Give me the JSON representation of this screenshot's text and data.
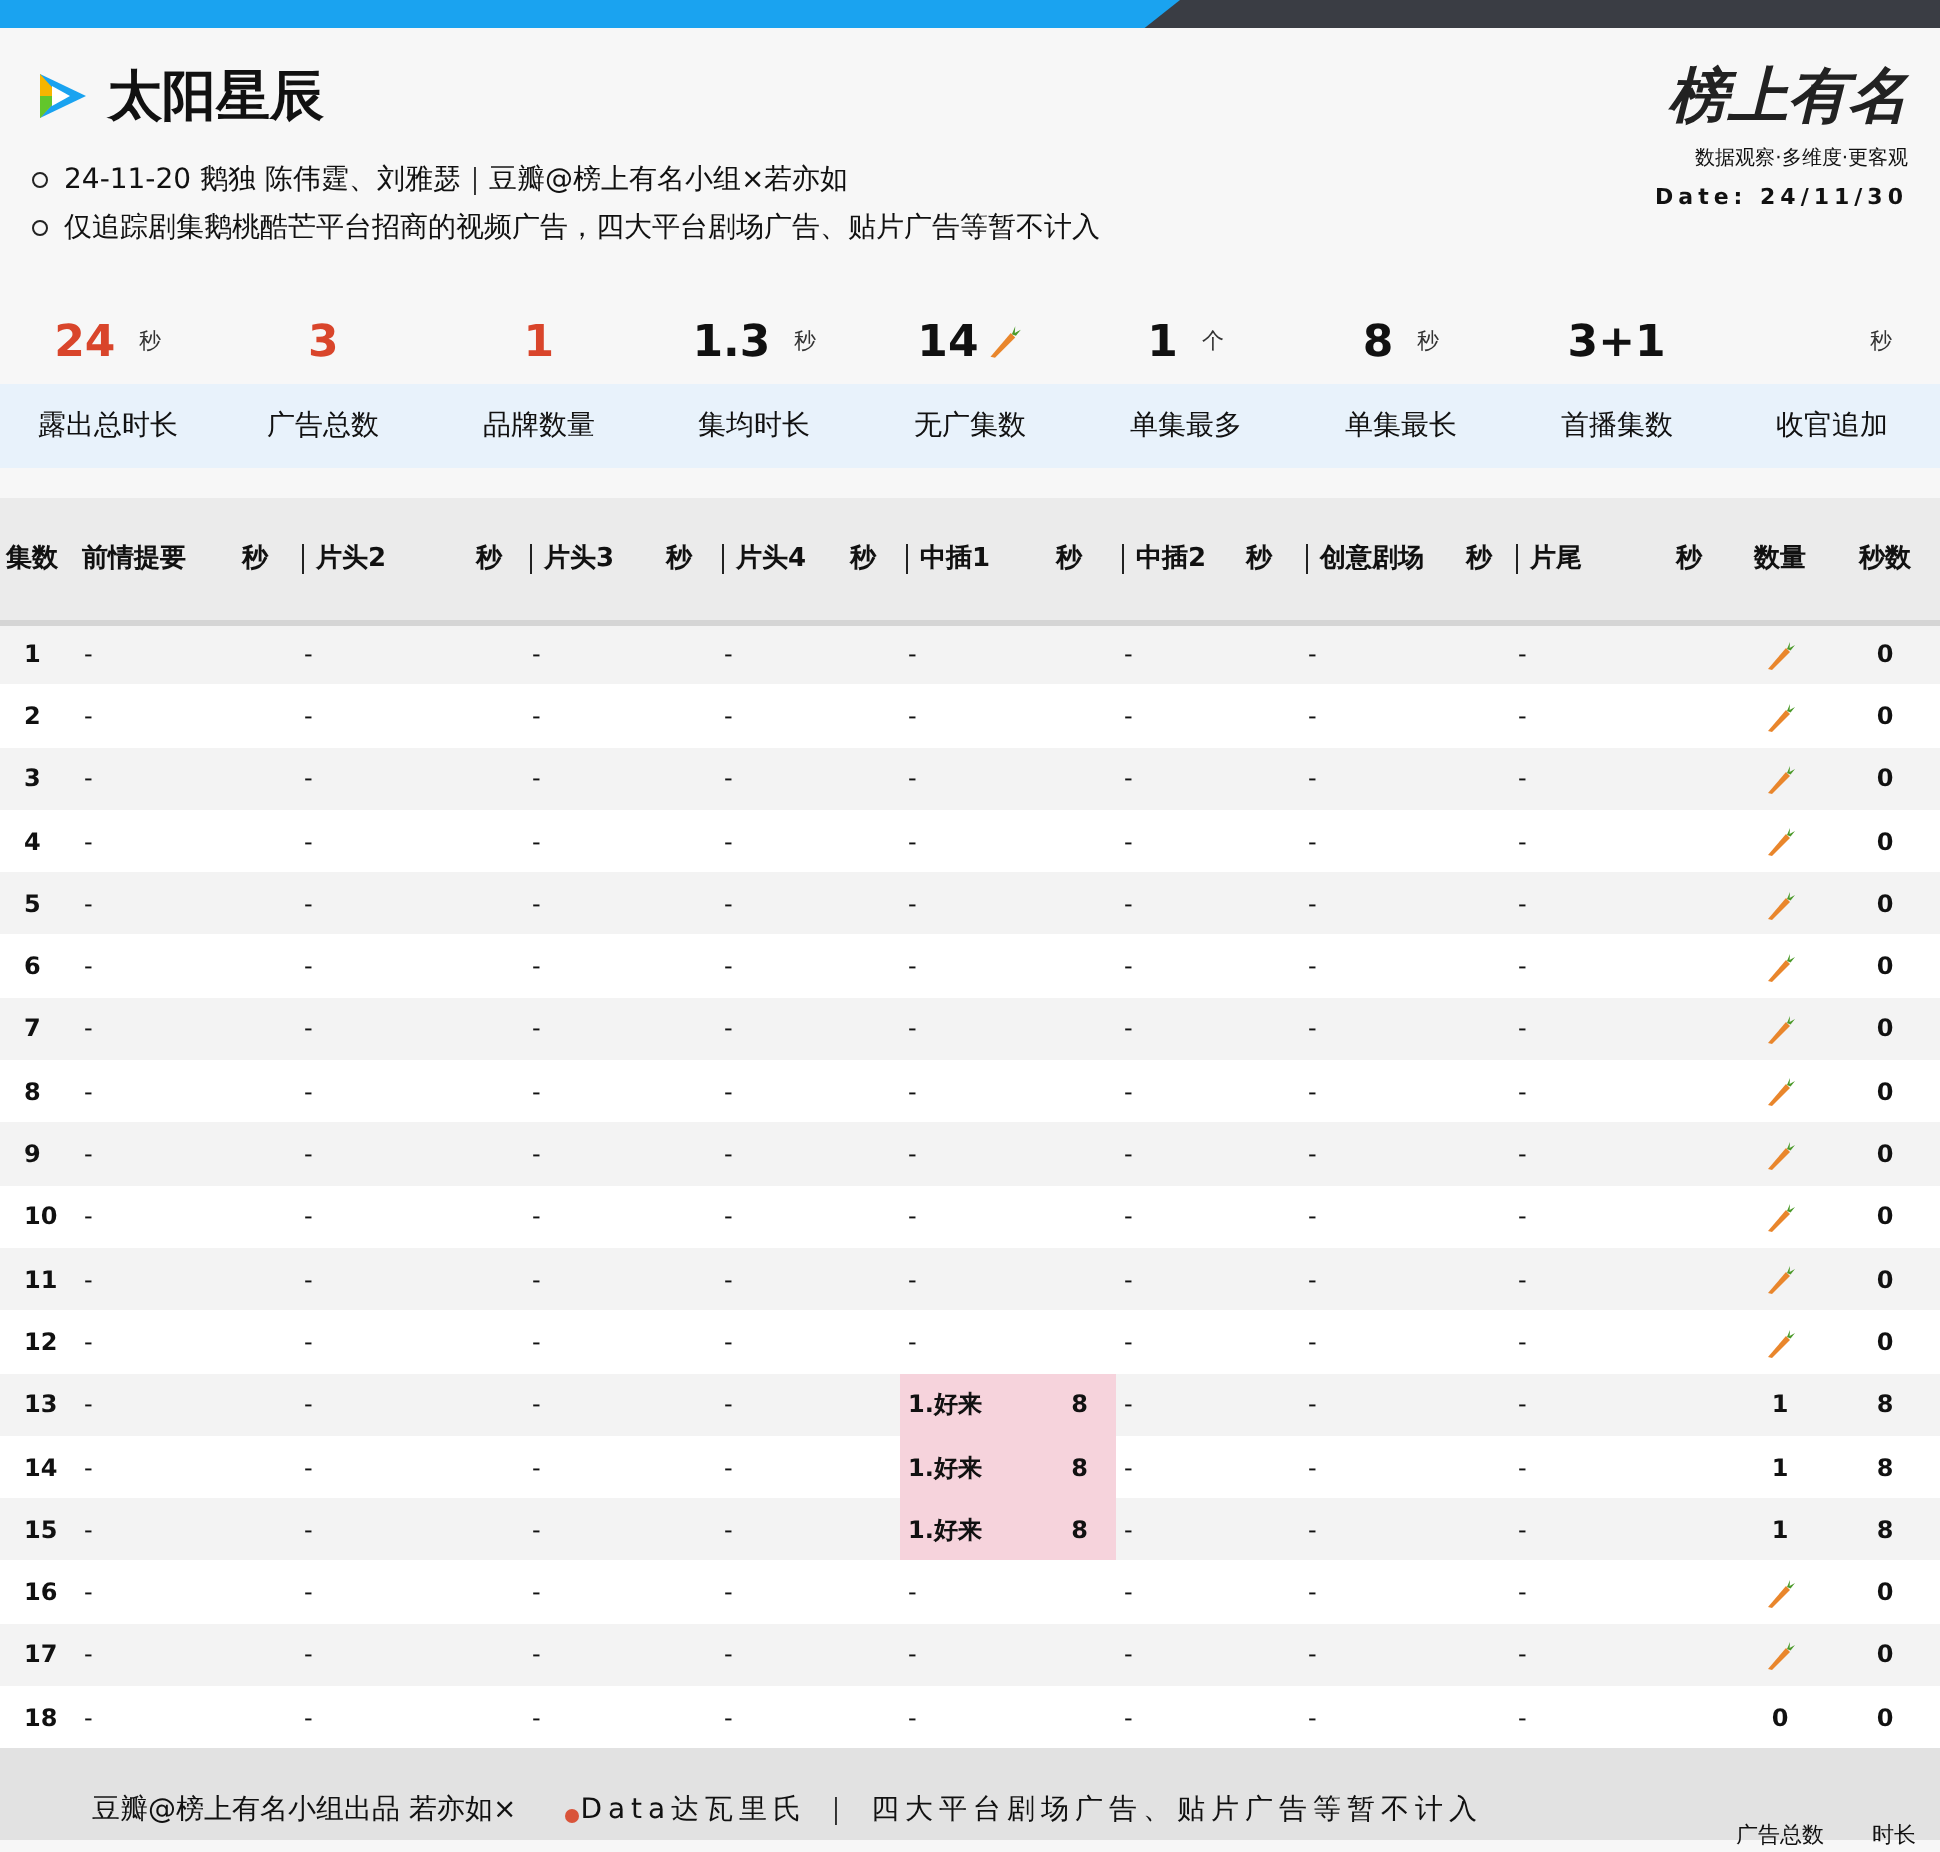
{
  "header": {
    "title": "太阳星辰",
    "notes": [
      "24-11-20 鹅独 陈伟霆、刘雅瑟｜豆瓣@榜上有名小组×若亦如",
      "仅追踪剧集鹅桃酷芒平台招商的视频广告，四大平台剧场广告、贴片广告等暂不计入"
    ],
    "brand": "榜上有名",
    "slogan": "数据观察·多维度·更客观",
    "date": "Date: 24/11/30"
  },
  "stats": [
    {
      "kind": "text_unit",
      "value": "24",
      "unit": "秒",
      "emphasized": true
    },
    {
      "kind": "plain",
      "value": "3",
      "emphasized": true
    },
    {
      "kind": "plain",
      "value": "1",
      "emphasized": true
    },
    {
      "kind": "text_unit",
      "value": "1.3",
      "unit": "秒",
      "emphasized": false
    },
    {
      "kind": "carrot_unit",
      "value": "14",
      "emphasized": false
    },
    {
      "kind": "text_unit",
      "value": "1",
      "unit": "个",
      "emphasized": false
    },
    {
      "kind": "text_unit",
      "value": "8",
      "unit": "秒",
      "emphasized": false
    },
    {
      "kind": "plain",
      "value": "3+1",
      "emphasized": false
    },
    {
      "kind": "text_unit",
      "unit": "秒",
      "emphasized": false
    }
  ],
  "stat_labels": [
    "露出总时长",
    "广告总数",
    "品牌数量",
    "集均时长",
    "无广集数",
    "单集最多",
    "单集最长",
    "首播集数",
    "收官追加"
  ],
  "table": {
    "columns": [
      {
        "label": "集数",
        "kind": "plain"
      },
      {
        "label": "前情提要",
        "kind": "first"
      },
      {
        "label": "秒",
        "kind": "unit"
      },
      {
        "label": "片头2",
        "kind": "segment"
      },
      {
        "label": "秒",
        "kind": "unit"
      },
      {
        "label": "片头3",
        "kind": "segment"
      },
      {
        "label": "秒",
        "kind": "unit"
      },
      {
        "label": "片头4",
        "kind": "segment"
      },
      {
        "label": "秒",
        "kind": "unit"
      },
      {
        "label": "中插1",
        "kind": "segment"
      },
      {
        "label": "秒",
        "kind": "unit"
      },
      {
        "label": "中插2",
        "kind": "segment"
      },
      {
        "label": "秒",
        "kind": "unit"
      },
      {
        "label": "创意剧场",
        "kind": "segment"
      },
      {
        "label": "秒",
        "kind": "unit"
      },
      {
        "label": "片尾",
        "kind": "segment"
      },
      {
        "label": "秒",
        "kind": "unit"
      },
      {
        "label": "数量",
        "kind": "center"
      },
      {
        "label": "秒数",
        "kind": "center"
      }
    ],
    "rows": [
      {
        "episode": "1",
        "segments": [
          {
            "kind": "empty",
            "text": "-"
          },
          {
            "kind": "empty",
            "text": "-"
          },
          {
            "kind": "empty",
            "text": "-"
          },
          {
            "kind": "empty",
            "text": "-"
          },
          {
            "kind": "empty",
            "text": "-"
          },
          {
            "kind": "empty",
            "text": "-"
          },
          {
            "kind": "empty",
            "text": "-"
          },
          {
            "kind": "empty",
            "text": "-"
          }
        ],
        "count": {
          "kind": "carrot"
        },
        "seconds": "0"
      },
      {
        "episode": "2",
        "segments": [
          {
            "kind": "empty",
            "text": "-"
          },
          {
            "kind": "empty",
            "text": "-"
          },
          {
            "kind": "empty",
            "text": "-"
          },
          {
            "kind": "empty",
            "text": "-"
          },
          {
            "kind": "empty",
            "text": "-"
          },
          {
            "kind": "empty",
            "text": "-"
          },
          {
            "kind": "empty",
            "text": "-"
          },
          {
            "kind": "empty",
            "text": "-"
          }
        ],
        "count": {
          "kind": "carrot"
        },
        "seconds": "0"
      },
      {
        "episode": "3",
        "segments": [
          {
            "kind": "empty",
            "text": "-"
          },
          {
            "kind": "empty",
            "text": "-"
          },
          {
            "kind": "empty",
            "text": "-"
          },
          {
            "kind": "empty",
            "text": "-"
          },
          {
            "kind": "empty",
            "text": "-"
          },
          {
            "kind": "empty",
            "text": "-"
          },
          {
            "kind": "empty",
            "text": "-"
          },
          {
            "kind": "empty",
            "text": "-"
          }
        ],
        "count": {
          "kind": "carrot"
        },
        "seconds": "0"
      },
      {
        "episode": "4",
        "segments": [
          {
            "kind": "empty",
            "text": "-"
          },
          {
            "kind": "empty",
            "text": "-"
          },
          {
            "kind": "empty",
            "text": "-"
          },
          {
            "kind": "empty",
            "text": "-"
          },
          {
            "kind": "empty",
            "text": "-"
          },
          {
            "kind": "empty",
            "text": "-"
          },
          {
            "kind": "empty",
            "text": "-"
          },
          {
            "kind": "empty",
            "text": "-"
          }
        ],
        "count": {
          "kind": "carrot"
        },
        "seconds": "0"
      },
      {
        "episode": "5",
        "segments": [
          {
            "kind": "empty",
            "text": "-"
          },
          {
            "kind": "empty",
            "text": "-"
          },
          {
            "kind": "empty",
            "text": "-"
          },
          {
            "kind": "empty",
            "text": "-"
          },
          {
            "kind": "empty",
            "text": "-"
          },
          {
            "kind": "empty",
            "text": "-"
          },
          {
            "kind": "empty",
            "text": "-"
          },
          {
            "kind": "empty",
            "text": "-"
          }
        ],
        "count": {
          "kind": "carrot"
        },
        "seconds": "0"
      },
      {
        "episode": "6",
        "segments": [
          {
            "kind": "empty",
            "text": "-"
          },
          {
            "kind": "empty",
            "text": "-"
          },
          {
            "kind": "empty",
            "text": "-"
          },
          {
            "kind": "empty",
            "text": "-"
          },
          {
            "kind": "empty",
            "text": "-"
          },
          {
            "kind": "empty",
            "text": "-"
          },
          {
            "kind": "empty",
            "text": "-"
          },
          {
            "kind": "empty",
            "text": "-"
          }
        ],
        "count": {
          "kind": "carrot"
        },
        "seconds": "0"
      },
      {
        "episode": "7",
        "segments": [
          {
            "kind": "empty",
            "text": "-"
          },
          {
            "kind": "empty",
            "text": "-"
          },
          {
            "kind": "empty",
            "text": "-"
          },
          {
            "kind": "empty",
            "text": "-"
          },
          {
            "kind": "empty",
            "text": "-"
          },
          {
            "kind": "empty",
            "text": "-"
          },
          {
            "kind": "empty",
            "text": "-"
          },
          {
            "kind": "empty",
            "text": "-"
          }
        ],
        "count": {
          "kind": "carrot"
        },
        "seconds": "0"
      },
      {
        "episode": "8",
        "segments": [
          {
            "kind": "empty",
            "text": "-"
          },
          {
            "kind": "empty",
            "text": "-"
          },
          {
            "kind": "empty",
            "text": "-"
          },
          {
            "kind": "empty",
            "text": "-"
          },
          {
            "kind": "empty",
            "text": "-"
          },
          {
            "kind": "empty",
            "text": "-"
          },
          {
            "kind": "empty",
            "text": "-"
          },
          {
            "kind": "empty",
            "text": "-"
          }
        ],
        "count": {
          "kind": "carrot"
        },
        "seconds": "0"
      },
      {
        "episode": "9",
        "segments": [
          {
            "kind": "empty",
            "text": "-"
          },
          {
            "kind": "empty",
            "text": "-"
          },
          {
            "kind": "empty",
            "text": "-"
          },
          {
            "kind": "empty",
            "text": "-"
          },
          {
            "kind": "empty",
            "text": "-"
          },
          {
            "kind": "empty",
            "text": "-"
          },
          {
            "kind": "empty",
            "text": "-"
          },
          {
            "kind": "empty",
            "text": "-"
          }
        ],
        "count": {
          "kind": "carrot"
        },
        "seconds": "0"
      },
      {
        "episode": "10",
        "segments": [
          {
            "kind": "empty",
            "text": "-"
          },
          {
            "kind": "empty",
            "text": "-"
          },
          {
            "kind": "empty",
            "text": "-"
          },
          {
            "kind": "empty",
            "text": "-"
          },
          {
            "kind": "empty",
            "text": "-"
          },
          {
            "kind": "empty",
            "text": "-"
          },
          {
            "kind": "empty",
            "text": "-"
          },
          {
            "kind": "empty",
            "text": "-"
          }
        ],
        "count": {
          "kind": "carrot"
        },
        "seconds": "0"
      },
      {
        "episode": "11",
        "segments": [
          {
            "kind": "empty",
            "text": "-"
          },
          {
            "kind": "empty",
            "text": "-"
          },
          {
            "kind": "empty",
            "text": "-"
          },
          {
            "kind": "empty",
            "text": "-"
          },
          {
            "kind": "empty",
            "text": "-"
          },
          {
            "kind": "empty",
            "text": "-"
          },
          {
            "kind": "empty",
            "text": "-"
          },
          {
            "kind": "empty",
            "text": "-"
          }
        ],
        "count": {
          "kind": "carrot"
        },
        "seconds": "0"
      },
      {
        "episode": "12",
        "segments": [
          {
            "kind": "empty",
            "text": "-"
          },
          {
            "kind": "empty",
            "text": "-"
          },
          {
            "kind": "empty",
            "text": "-"
          },
          {
            "kind": "empty",
            "text": "-"
          },
          {
            "kind": "empty",
            "text": "-"
          },
          {
            "kind": "empty",
            "text": "-"
          },
          {
            "kind": "empty",
            "text": "-"
          },
          {
            "kind": "empty",
            "text": "-"
          }
        ],
        "count": {
          "kind": "carrot"
        },
        "seconds": "0"
      },
      {
        "episode": "13",
        "segments": [
          {
            "kind": "empty",
            "text": "-"
          },
          {
            "kind": "empty",
            "text": "-"
          },
          {
            "kind": "empty",
            "text": "-"
          },
          {
            "kind": "empty",
            "text": "-"
          },
          {
            "kind": "ad",
            "text": "1.好来",
            "seconds": "8"
          },
          {
            "kind": "empty",
            "text": "-"
          },
          {
            "kind": "empty",
            "text": "-"
          },
          {
            "kind": "empty",
            "text": "-"
          }
        ],
        "count": {
          "kind": "text",
          "text": "1"
        },
        "seconds": "8"
      },
      {
        "episode": "14",
        "segments": [
          {
            "kind": "empty",
            "text": "-"
          },
          {
            "kind": "empty",
            "text": "-"
          },
          {
            "kind": "empty",
            "text": "-"
          },
          {
            "kind": "empty",
            "text": "-"
          },
          {
            "kind": "ad",
            "text": "1.好来",
            "seconds": "8"
          },
          {
            "kind": "empty",
            "text": "-"
          },
          {
            "kind": "empty",
            "text": "-"
          },
          {
            "kind": "empty",
            "text": "-"
          }
        ],
        "count": {
          "kind": "text",
          "text": "1"
        },
        "seconds": "8"
      },
      {
        "episode": "15",
        "segments": [
          {
            "kind": "empty",
            "text": "-"
          },
          {
            "kind": "empty",
            "text": "-"
          },
          {
            "kind": "empty",
            "text": "-"
          },
          {
            "kind": "empty",
            "text": "-"
          },
          {
            "kind": "ad",
            "text": "1.好来",
            "seconds": "8"
          },
          {
            "kind": "empty",
            "text": "-"
          },
          {
            "kind": "empty",
            "text": "-"
          },
          {
            "kind": "empty",
            "text": "-"
          }
        ],
        "count": {
          "kind": "text",
          "text": "1"
        },
        "seconds": "8"
      },
      {
        "episode": "16",
        "segments": [
          {
            "kind": "empty",
            "text": "-"
          },
          {
            "kind": "empty",
            "text": "-"
          },
          {
            "kind": "empty",
            "text": "-"
          },
          {
            "kind": "empty",
            "text": "-"
          },
          {
            "kind": "empty",
            "text": "-"
          },
          {
            "kind": "empty",
            "text": "-"
          },
          {
            "kind": "empty",
            "text": "-"
          },
          {
            "kind": "empty",
            "text": "-"
          }
        ],
        "count": {
          "kind": "carrot"
        },
        "seconds": "0"
      },
      {
        "episode": "17",
        "segments": [
          {
            "kind": "empty",
            "text": "-"
          },
          {
            "kind": "empty",
            "text": "-"
          },
          {
            "kind": "empty",
            "text": "-"
          },
          {
            "kind": "empty",
            "text": "-"
          },
          {
            "kind": "empty",
            "text": "-"
          },
          {
            "kind": "empty",
            "text": "-"
          },
          {
            "kind": "empty",
            "text": "-"
          },
          {
            "kind": "empty",
            "text": "-"
          }
        ],
        "count": {
          "kind": "carrot"
        },
        "seconds": "0"
      },
      {
        "episode": "18",
        "segments": [
          {
            "kind": "empty",
            "text": "-"
          },
          {
            "kind": "empty",
            "text": "-"
          },
          {
            "kind": "empty",
            "text": "-"
          },
          {
            "kind": "empty",
            "text": "-"
          },
          {
            "kind": "empty",
            "text": "-"
          },
          {
            "kind": "empty",
            "text": "-"
          },
          {
            "kind": "empty",
            "text": "-"
          },
          {
            "kind": "empty",
            "text": "-"
          }
        ],
        "count": {
          "kind": "text",
          "text": "0"
        },
        "seconds": "0"
      }
    ]
  },
  "footer": {
    "credit": "豆瓣@榜上有名小组出品 若亦如×",
    "source": "Data达瓦里氏 ｜ 四大平台剧场广告、贴片广告等暂不计入",
    "cut_labels": [
      "广告总数",
      "时长"
    ]
  }
}
